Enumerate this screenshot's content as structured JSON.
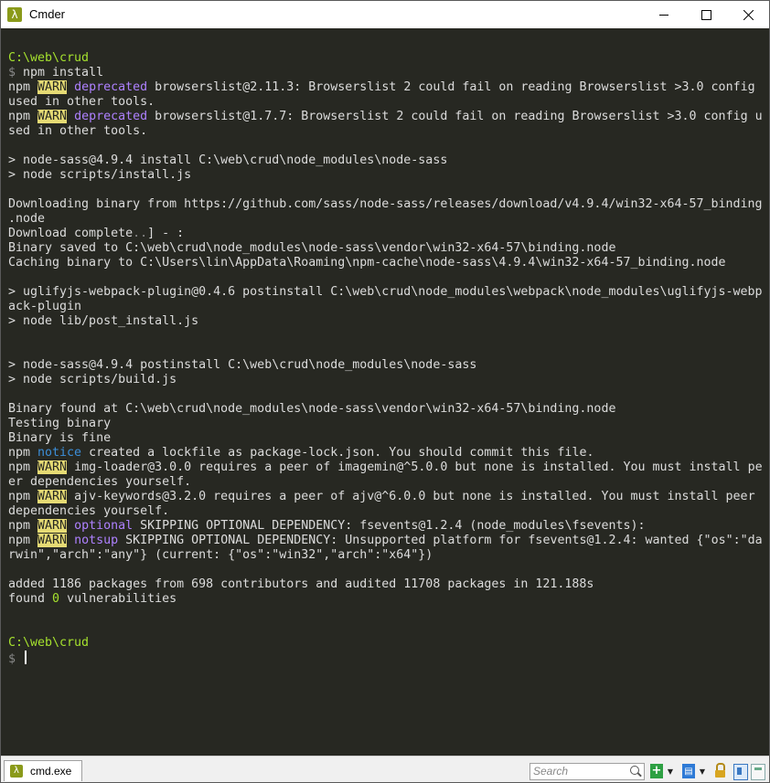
{
  "window": {
    "title": "Cmder"
  },
  "terminal": {
    "lines": [
      [
        [
          "path",
          "C:\\web\\crud"
        ]
      ],
      [
        [
          "dim",
          "$ "
        ],
        [
          "t",
          "npm install"
        ]
      ],
      [
        [
          "t",
          "npm "
        ],
        [
          "warn",
          "WARN"
        ],
        [
          "t",
          " "
        ],
        [
          "deprec",
          "deprecated"
        ],
        [
          "t",
          " browserslist@2.11.3: Browserslist 2 could fail on reading Browserslist >3.0 config"
        ]
      ],
      [
        [
          "t",
          "used in other tools."
        ]
      ],
      [
        [
          "t",
          "npm "
        ],
        [
          "warn",
          "WARN"
        ],
        [
          "t",
          " "
        ],
        [
          "deprec",
          "deprecated"
        ],
        [
          "t",
          " browserslist@1.7.7: Browserslist 2 could fail on reading Browserslist >3.0 config u"
        ]
      ],
      [
        [
          "t",
          "sed in other tools."
        ]
      ],
      [],
      [
        [
          "t",
          "> node-sass@4.9.4 install C:\\web\\crud\\node_modules\\node-sass"
        ]
      ],
      [
        [
          "t",
          "> node scripts/install.js"
        ]
      ],
      [],
      [
        [
          "t",
          "Downloading binary from https://github.com/sass/node-sass/releases/download/v4.9.4/win32-x64-57_binding"
        ]
      ],
      [
        [
          "t",
          ".node"
        ]
      ],
      [
        [
          "t",
          "Download complete"
        ],
        [
          "dim",
          ".."
        ],
        [
          "t",
          "] - :"
        ]
      ],
      [
        [
          "t",
          "Binary saved to C:\\web\\crud\\node_modules\\node-sass\\vendor\\win32-x64-57\\binding.node"
        ]
      ],
      [
        [
          "t",
          "Caching binary to C:\\Users\\lin\\AppData\\Roaming\\npm-cache\\node-sass\\4.9.4\\win32-x64-57_binding.node"
        ]
      ],
      [],
      [
        [
          "t",
          "> uglifyjs-webpack-plugin@0.4.6 postinstall C:\\web\\crud\\node_modules\\webpack\\node_modules\\uglifyjs-webp"
        ]
      ],
      [
        [
          "t",
          "ack-plugin"
        ]
      ],
      [
        [
          "t",
          "> node lib/post_install.js"
        ]
      ],
      [],
      [],
      [
        [
          "t",
          "> node-sass@4.9.4 postinstall C:\\web\\crud\\node_modules\\node-sass"
        ]
      ],
      [
        [
          "t",
          "> node scripts/build.js"
        ]
      ],
      [],
      [
        [
          "t",
          "Binary found at C:\\web\\crud\\node_modules\\node-sass\\vendor\\win32-x64-57\\binding.node"
        ]
      ],
      [
        [
          "t",
          "Testing binary"
        ]
      ],
      [
        [
          "t",
          "Binary is fine"
        ]
      ],
      [
        [
          "t",
          "npm "
        ],
        [
          "notice",
          "notice"
        ],
        [
          "t",
          " created a lockfile as package-lock.json. You should commit this file."
        ]
      ],
      [
        [
          "t",
          "npm "
        ],
        [
          "warn",
          "WARN"
        ],
        [
          "t",
          " img-loader@3.0.0 requires a peer of imagemin@^5.0.0 but none is installed. You must install pe"
        ]
      ],
      [
        [
          "t",
          "er dependencies yourself."
        ]
      ],
      [
        [
          "t",
          "npm "
        ],
        [
          "warn",
          "WARN"
        ],
        [
          "t",
          " ajv-keywords@3.2.0 requires a peer of ajv@^6.0.0 but none is installed. You must install peer"
        ]
      ],
      [
        [
          "t",
          "dependencies yourself."
        ]
      ],
      [
        [
          "t",
          "npm "
        ],
        [
          "warn",
          "WARN"
        ],
        [
          "t",
          " "
        ],
        [
          "deprec",
          "optional"
        ],
        [
          "t",
          " SKIPPING OPTIONAL DEPENDENCY: fsevents@1.2.4 (node_modules\\fsevents):"
        ]
      ],
      [
        [
          "t",
          "npm "
        ],
        [
          "warn",
          "WARN"
        ],
        [
          "t",
          " "
        ],
        [
          "deprec",
          "notsup"
        ],
        [
          "t",
          " SKIPPING OPTIONAL DEPENDENCY: Unsupported platform for fsevents@1.2.4: wanted {\"os\":\"da"
        ]
      ],
      [
        [
          "t",
          "rwin\",\"arch\":\"any\"} (current: {\"os\":\"win32\",\"arch\":\"x64\"})"
        ]
      ],
      [],
      [
        [
          "t",
          "added 1186 packages from 698 contributors and audited 11708 packages in 121.188s"
        ]
      ],
      [
        [
          "t",
          "found "
        ],
        [
          "path",
          "0"
        ],
        [
          "t",
          " vulnerabilities"
        ]
      ],
      [],
      [],
      [
        [
          "path",
          "C:\\web\\crud"
        ]
      ],
      [
        [
          "dim",
          "$ "
        ],
        [
          "cursor",
          ""
        ]
      ]
    ]
  },
  "statusbar": {
    "tab_label": "cmd.exe",
    "search_placeholder": "Search"
  },
  "icons": {
    "app": "lambda-icon",
    "new_console": "plus-icon",
    "consoles": "console-list-icon",
    "lock": "lock-icon"
  },
  "colors": {
    "background": "#272822",
    "text": "#dcdcdc",
    "path": "#a6e22e",
    "warn_bg": "#e6db74",
    "deprecated": "#ae81ff",
    "notice": "#3c8ed8"
  }
}
